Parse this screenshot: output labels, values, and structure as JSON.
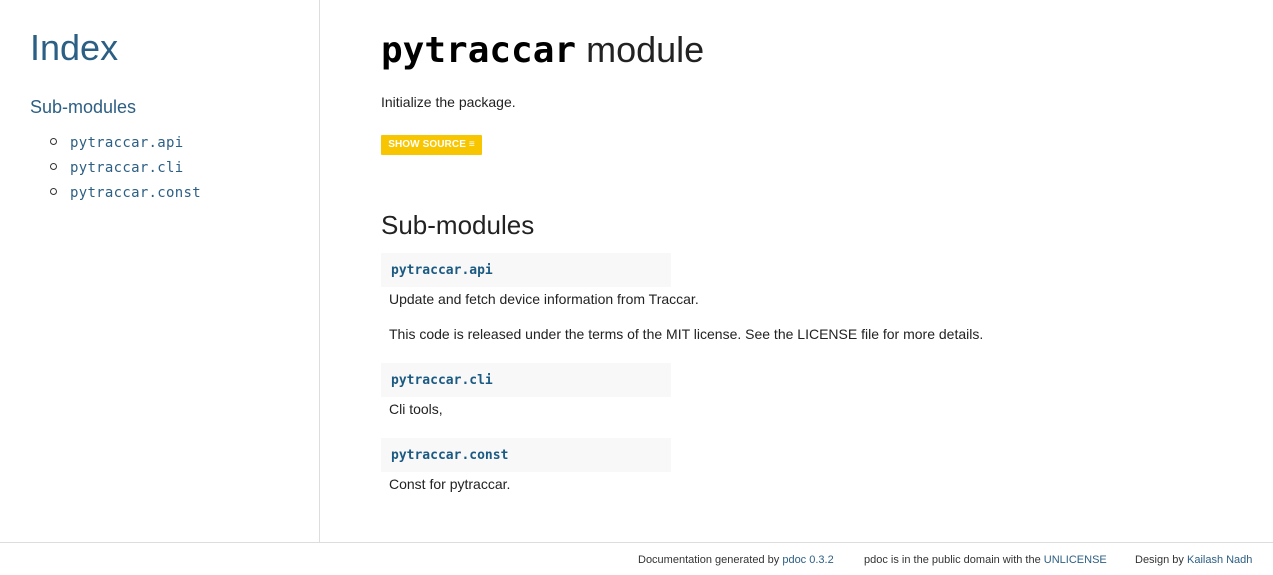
{
  "sidebar": {
    "title": "Index",
    "section_heading": "Sub-modules",
    "items": [
      {
        "label": "pytraccar.api"
      },
      {
        "label": "pytraccar.cli"
      },
      {
        "label": "pytraccar.const"
      }
    ]
  },
  "main": {
    "title_code": "pytraccar",
    "title_suffix": " module",
    "description": "Initialize the package.",
    "show_source_label": "SHOW SOURCE ≡",
    "submodules_heading": "Sub-modules",
    "submodules": [
      {
        "name": "pytraccar.api",
        "desc1": "Update and fetch device information from Traccar.",
        "desc2": "This code is released under the terms of the MIT license. See the LICENSE file for more details."
      },
      {
        "name": "pytraccar.cli",
        "desc1": "Cli tools,"
      },
      {
        "name": "pytraccar.const",
        "desc1": "Const for pytraccar."
      }
    ]
  },
  "footer": {
    "generated_prefix": "Documentation generated by ",
    "generated_link": "pdoc 0.3.2",
    "license_prefix": "pdoc is in the public domain with the ",
    "license_link": "UNLICENSE",
    "design_prefix": "Design by ",
    "design_link": "Kailash Nadh"
  },
  "colors": {
    "link": "#2c5f84",
    "button": "#f7c600",
    "code_bg": "#f8f8f8"
  }
}
